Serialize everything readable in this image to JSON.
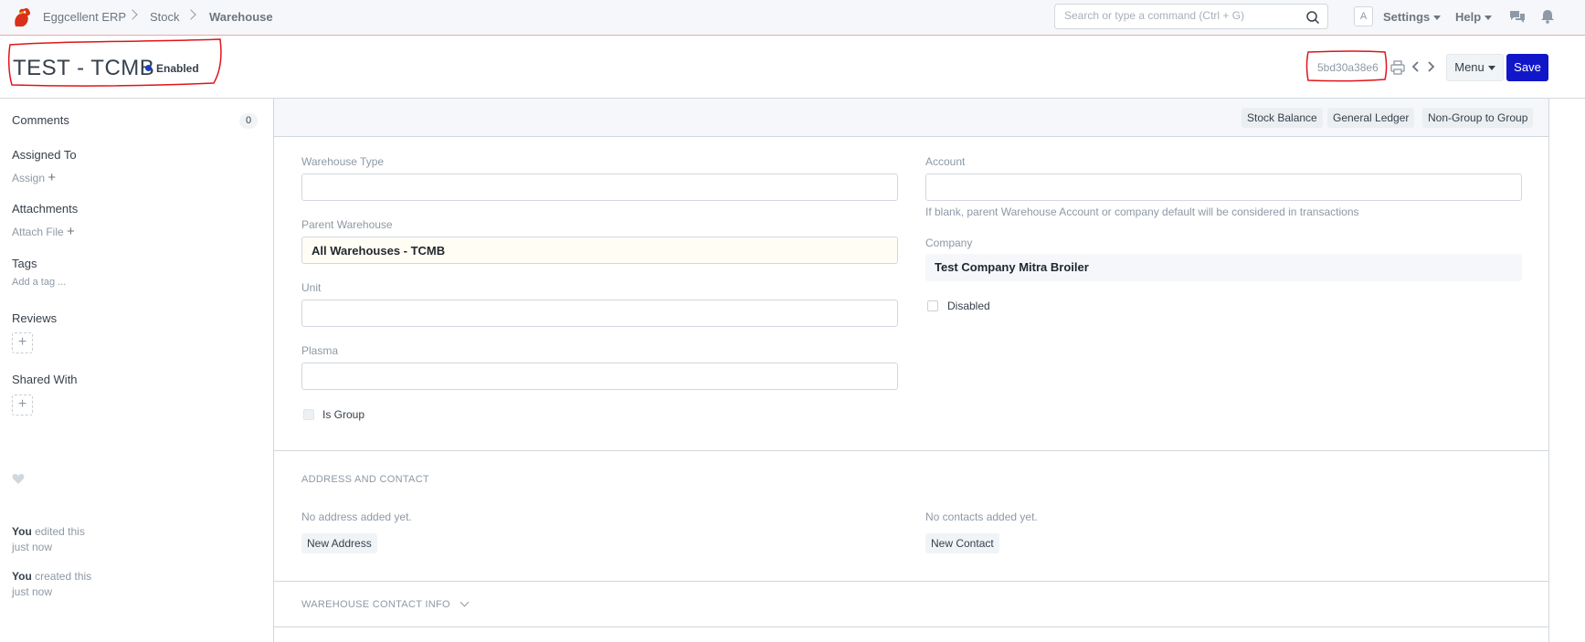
{
  "navbar": {
    "breadcrumbs": [
      "Eggcellent ERP",
      "Stock",
      "Warehouse"
    ],
    "search_placeholder": "Search or type a command (Ctrl + G)",
    "avatar": "A",
    "settings": "Settings",
    "help": "Help",
    "icons": [
      "app-logo-icon",
      "search-icon",
      "chat-icon",
      "bell-icon"
    ]
  },
  "page_head": {
    "title": "TEST - TCMB",
    "status": "Enabled",
    "status_color": "#1a3ec0",
    "doc_name": "5bd30a38e6",
    "menu_label": "Menu",
    "save_label": "Save",
    "accent_color": "#1117c9"
  },
  "sidebar": {
    "comments_label": "Comments",
    "comments_count": "0",
    "assigned_to_label": "Assigned To",
    "assign_label": "Assign",
    "attachments_label": "Attachments",
    "attach_file_label": "Attach File",
    "tags_label": "Tags",
    "add_tag_label": "Add a tag ...",
    "reviews_label": "Reviews",
    "shared_with_label": "Shared With",
    "activity": [
      {
        "who": "You",
        "what": "edited this",
        "when": "just now"
      },
      {
        "who": "You",
        "what": "created this",
        "when": "just now"
      }
    ]
  },
  "toolbar": {
    "buttons": [
      "Stock Balance",
      "General Ledger",
      "Non-Group to Group"
    ]
  },
  "form": {
    "warehouse_type_label": "Warehouse Type",
    "warehouse_type_value": "",
    "parent_warehouse_label": "Parent Warehouse",
    "parent_warehouse_value": "All Warehouses - TCMB",
    "unit_label": "Unit",
    "unit_value": "",
    "plasma_label": "Plasma",
    "plasma_value": "",
    "is_group_label": "Is Group",
    "is_group_checked": false,
    "account_label": "Account",
    "account_value": "",
    "account_help": "If blank, parent Warehouse Account or company default will be considered in transactions",
    "company_label": "Company",
    "company_value": "Test Company Mitra Broiler",
    "disabled_label": "Disabled",
    "disabled_checked": false
  },
  "address_contact": {
    "section_title": "ADDRESS AND CONTACT",
    "no_address_text": "No address added yet.",
    "new_address_label": "New Address",
    "no_contacts_text": "No contacts added yet.",
    "new_contact_label": "New Contact"
  },
  "warehouse_contact_info": {
    "section_title": "WAREHOUSE CONTACT INFO"
  }
}
